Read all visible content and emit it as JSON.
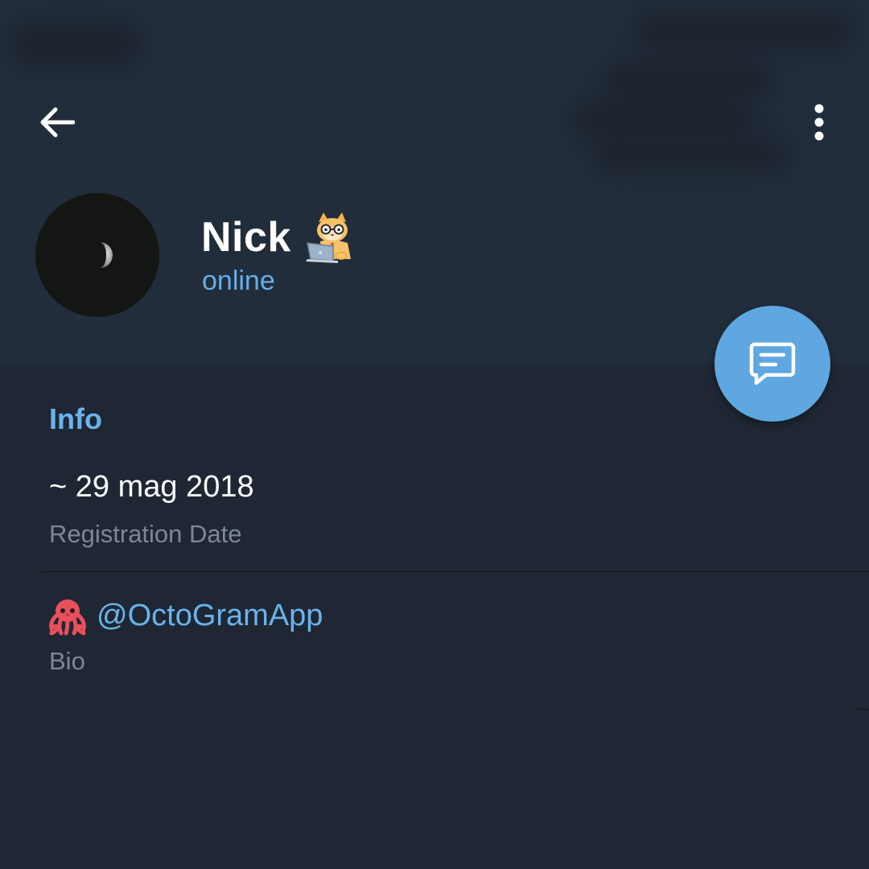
{
  "header": {
    "back_icon": "arrow-left-icon",
    "menu_icon": "more-vertical-icon"
  },
  "profile": {
    "name": "Nick",
    "name_sticker": "cat-with-laptop-sticker",
    "status": "online",
    "avatar_image": "moon-icon"
  },
  "fab": {
    "icon": "message-icon"
  },
  "info": {
    "section_title": "Info",
    "registration_value": "~ 29 mag 2018",
    "registration_label": "Registration Date",
    "bio_emoji": "octopus-emoji",
    "bio_value": "@OctoGramApp",
    "bio_label": "Bio"
  },
  "colors": {
    "header_bg": "#222d3b",
    "page_bg": "#1e2733",
    "accent": "#6ab3ec",
    "fab_bg": "#5ea7e1",
    "text_primary": "#ffffff",
    "text_secondary": "#7d8894"
  }
}
